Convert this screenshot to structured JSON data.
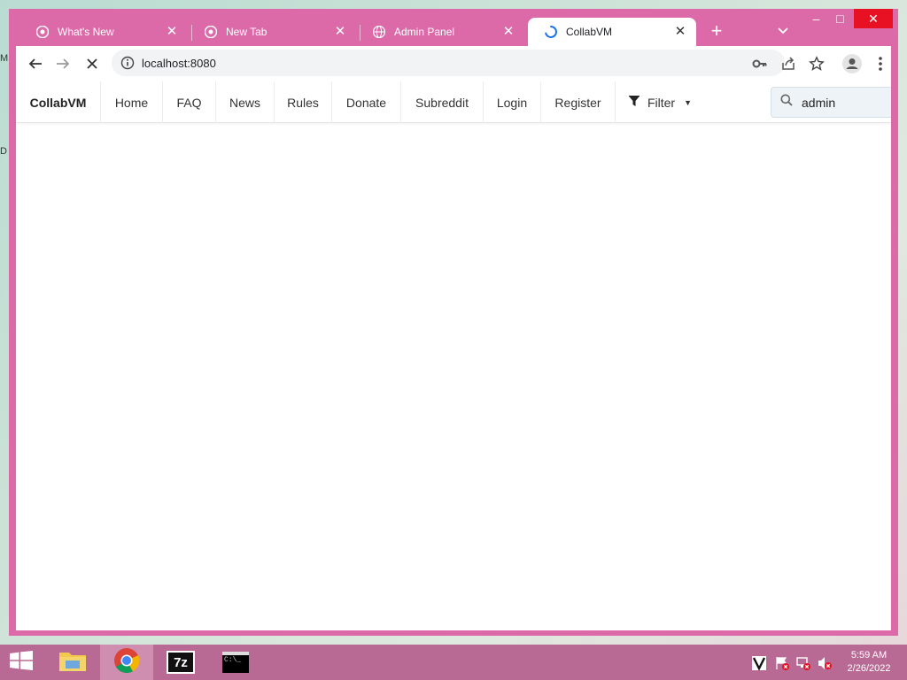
{
  "desktop": {
    "frag_top": "M",
    "frag_mid": "D"
  },
  "browser": {
    "tabs": [
      {
        "title": "What's New",
        "icon": "chrome-icon"
      },
      {
        "title": "New Tab",
        "icon": "chrome-icon"
      },
      {
        "title": "Admin Panel",
        "icon": "globe-icon"
      },
      {
        "title": "CollabVM",
        "icon": "loading-spinner-icon",
        "active": true
      }
    ],
    "new_tab": "+",
    "close_glyph": "✕",
    "window_controls": {
      "minimize": "–",
      "maximize": "□",
      "close": "✕"
    },
    "url": "localhost:8080"
  },
  "site": {
    "brand": "CollabVM",
    "nav": [
      "Home",
      "FAQ",
      "News",
      "Rules",
      "Donate",
      "Subreddit",
      "Login",
      "Register"
    ],
    "filter_label": "Filter",
    "filter_caret": "▼",
    "search_value": "admin"
  },
  "taskbar": {
    "clock_time": "5:59 AM",
    "clock_date": "2/26/2022",
    "sevenzip_label": "7z",
    "cmd_label": "C:\\_"
  },
  "colors": {
    "window_frame": "#dd6aa8",
    "taskbar": "#b86a95",
    "spinner": "#1a73e8",
    "close_button": "#e81123"
  }
}
